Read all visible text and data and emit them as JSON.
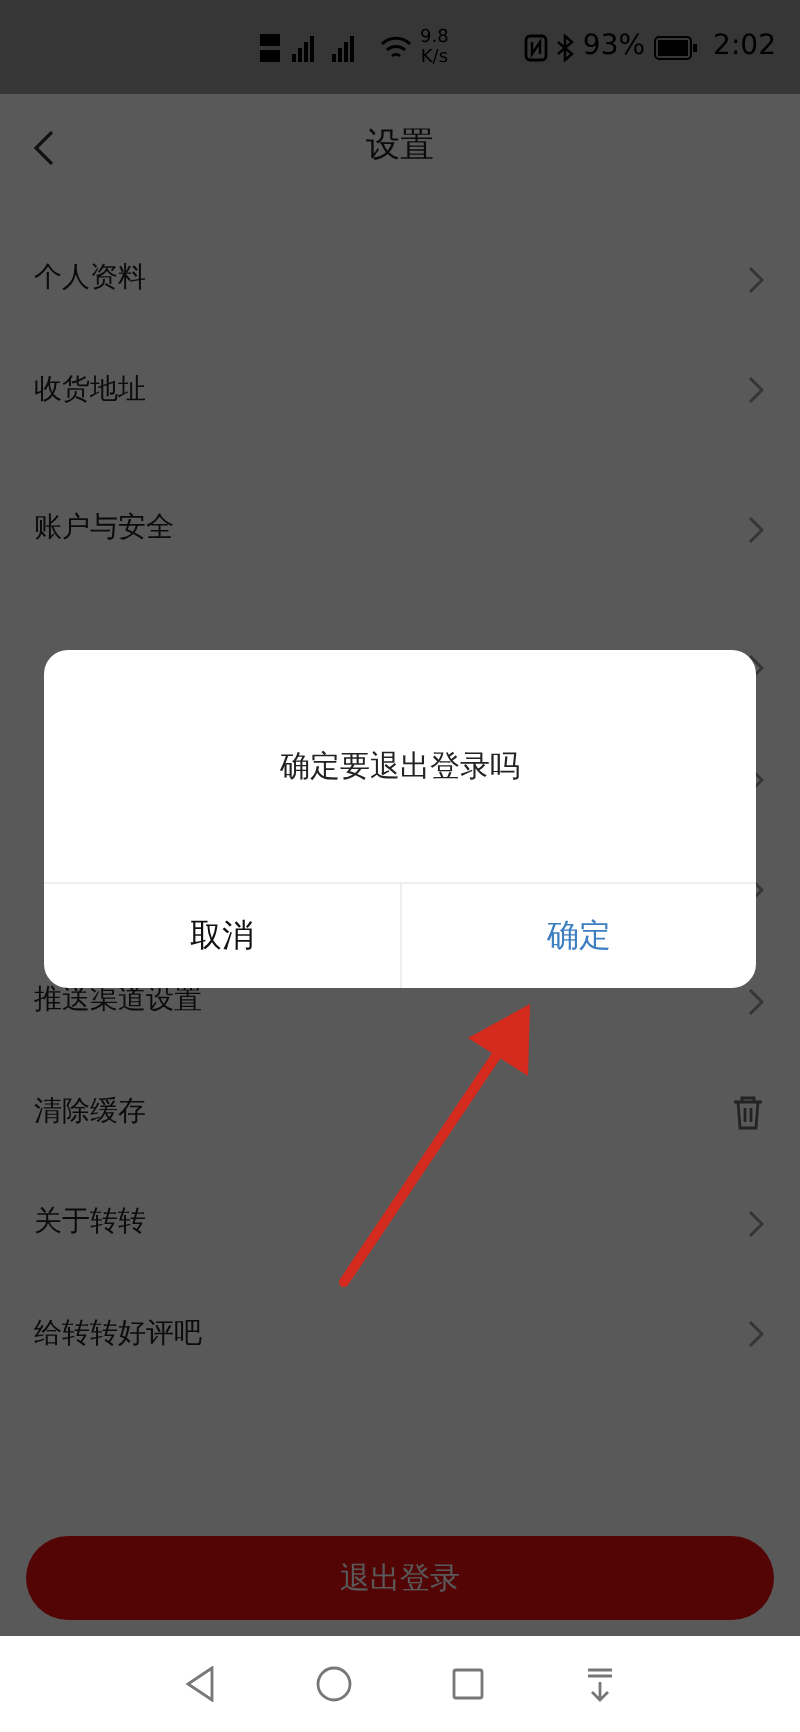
{
  "status_bar": {
    "speed_value": "9.8",
    "speed_unit": "K/s",
    "battery": "93%",
    "time": "2:02"
  },
  "header": {
    "title": "设置"
  },
  "sections": [
    {
      "items": [
        {
          "label": "个人资料",
          "kind": "link"
        },
        {
          "label": "收货地址",
          "kind": "link"
        }
      ]
    },
    {
      "items": [
        {
          "label": "账户与安全",
          "kind": "link"
        }
      ]
    },
    {
      "items": [
        {
          "kind": "link"
        },
        {
          "kind": "link"
        },
        {
          "kind": "link"
        },
        {
          "label": "推送渠道设置",
          "kind": "link"
        },
        {
          "label": "清除缓存",
          "kind": "trash"
        },
        {
          "label": "关于转转",
          "kind": "link"
        },
        {
          "label": "给转转好评吧",
          "kind": "link"
        }
      ]
    }
  ],
  "logout_button": "退出登录",
  "dialog": {
    "message": "确定要退出登录吗",
    "buttons": [
      {
        "label": "取消",
        "primary": false
      },
      {
        "label": "确定",
        "primary": true
      }
    ]
  }
}
